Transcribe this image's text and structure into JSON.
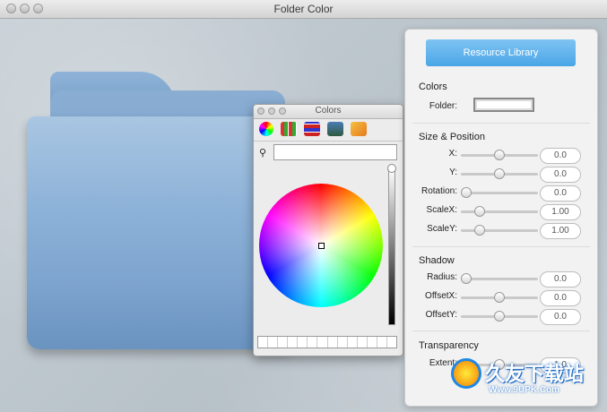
{
  "window": {
    "title": "Folder Color"
  },
  "colors_panel": {
    "title": "Colors",
    "tools": [
      "color-wheel-icon",
      "color-sliders-icon",
      "color-palettes-icon",
      "image-palettes-icon",
      "crayons-icon"
    ],
    "search_value": ""
  },
  "inspector": {
    "resource_library_label": "Resource Library",
    "colors": {
      "title": "Colors",
      "folder_label": "Folder:"
    },
    "size_position": {
      "title": "Size & Position",
      "rows": [
        {
          "label": "X:",
          "value": "0.0",
          "knob": 0.5
        },
        {
          "label": "Y:",
          "value": "0.0",
          "knob": 0.5
        },
        {
          "label": "Rotation:",
          "value": "0.0",
          "knob": 0.0
        },
        {
          "label": "ScaleX:",
          "value": "1.00",
          "knob": 0.2
        },
        {
          "label": "ScaleY:",
          "value": "1.00",
          "knob": 0.2
        }
      ]
    },
    "shadow": {
      "title": "Shadow",
      "rows": [
        {
          "label": "Radius:",
          "value": "0.0",
          "knob": 0.0
        },
        {
          "label": "OffsetX:",
          "value": "0.0",
          "knob": 0.5
        },
        {
          "label": "OffsetY:",
          "value": "0.0",
          "knob": 0.5
        }
      ]
    },
    "transparency": {
      "title": "Transparency",
      "rows": [
        {
          "label": "Extent:",
          "value": "1.0",
          "knob": 0.5
        }
      ]
    }
  },
  "watermark": {
    "brand": "久友下载站",
    "url": "Www.9UPK.Com"
  },
  "colors": {
    "accent": "#4aa6e6",
    "folder": "#8db2d8"
  }
}
